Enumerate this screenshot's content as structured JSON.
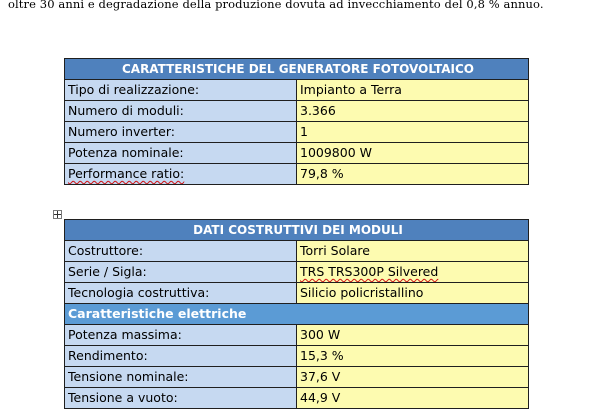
{
  "document": {
    "intro_text": "oltre 30 anni e degradazione della produzione dovuta ad invecchiamento del 0,8 % annuo."
  },
  "table_generator": {
    "title": "CARATTERISTICHE DEL GENERATORE FOTOVOLTAICO",
    "rows": [
      {
        "label": "Tipo di realizzazione:",
        "value": "Impianto a Terra"
      },
      {
        "label": "Numero di moduli:",
        "value": "3.366"
      },
      {
        "label": "Numero inverter:",
        "value": "1"
      },
      {
        "label": "Potenza nominale:",
        "value": "1009800 W"
      },
      {
        "label": "Performance ratio:",
        "value": "79,8 %"
      }
    ]
  },
  "table_modules": {
    "title": "DATI COSTRUTTIVI DEI MODULI",
    "rows": [
      {
        "label": "Costruttore:",
        "value": "Torri Solare"
      },
      {
        "label": "Serie / Sigla:",
        "value": "TRS TRS300P Silvered"
      },
      {
        "label": "Tecnologia costruttiva:",
        "value": "Silicio policristallino"
      }
    ],
    "subheader": "Caratteristiche elettriche",
    "electrical_rows": [
      {
        "label": "Potenza massima:",
        "value": "300 W"
      },
      {
        "label": "Rendimento:",
        "value": "15,3 %"
      },
      {
        "label": "Tensione nominale:",
        "value": "37,6 V"
      },
      {
        "label": "Tensione a vuoto:",
        "value": "44,9 V"
      }
    ]
  },
  "icons": {
    "table_anchor": "move-handle-icon"
  }
}
